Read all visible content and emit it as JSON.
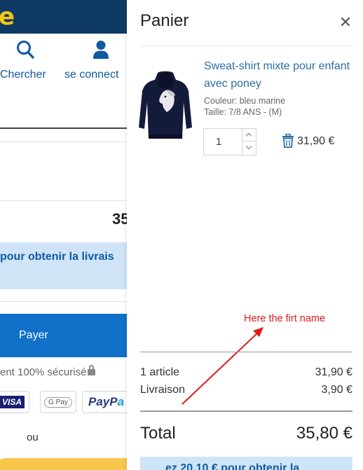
{
  "background_page": {
    "logo_fragment": "e",
    "nav": {
      "search_label": "Chercher",
      "login_label": "se connect",
      "search_icon": "search-icon",
      "user_icon": "user-icon"
    },
    "total_fragment": "35",
    "banner_fragment": "pour obtenir la livrais",
    "pay_button_label": "Payer",
    "secure_text": "ent 100% sécurisé",
    "payment_logos": {
      "visa": "VISA",
      "gpay": "G Pay",
      "paypal_a": "PayP",
      "paypal_b": "a"
    },
    "or_text": "ou"
  },
  "cart": {
    "title": "Panier",
    "close_icon": "close-icon",
    "item": {
      "name": "Sweat-shirt mixte pour enfant avec poney",
      "color": "Couleur: bleu marine",
      "size": "Taille: 7/8 ANS - (M)",
      "quantity": "1",
      "price": "31,90 €",
      "image_icon": "hoodie-image",
      "delete_icon": "trash-icon"
    },
    "annotation": "Here the firt name",
    "summary": {
      "articles_label": "1 article",
      "articles_value": "31,90 €",
      "shipping_label": "Livraison",
      "shipping_value": "3,90 €",
      "total_label": "Total",
      "total_value": "35,80 €"
    },
    "banner_fragment": "ez 20,10 € pour obtenir la"
  },
  "colors": {
    "header_navy": "#0f3a63",
    "brand_yellow": "#f5c518",
    "link_blue": "#2d6ca2",
    "pay_button_blue": "#1170c8",
    "banner_light_blue": "#cfe4f7",
    "annotation_red": "#e01a1a"
  }
}
